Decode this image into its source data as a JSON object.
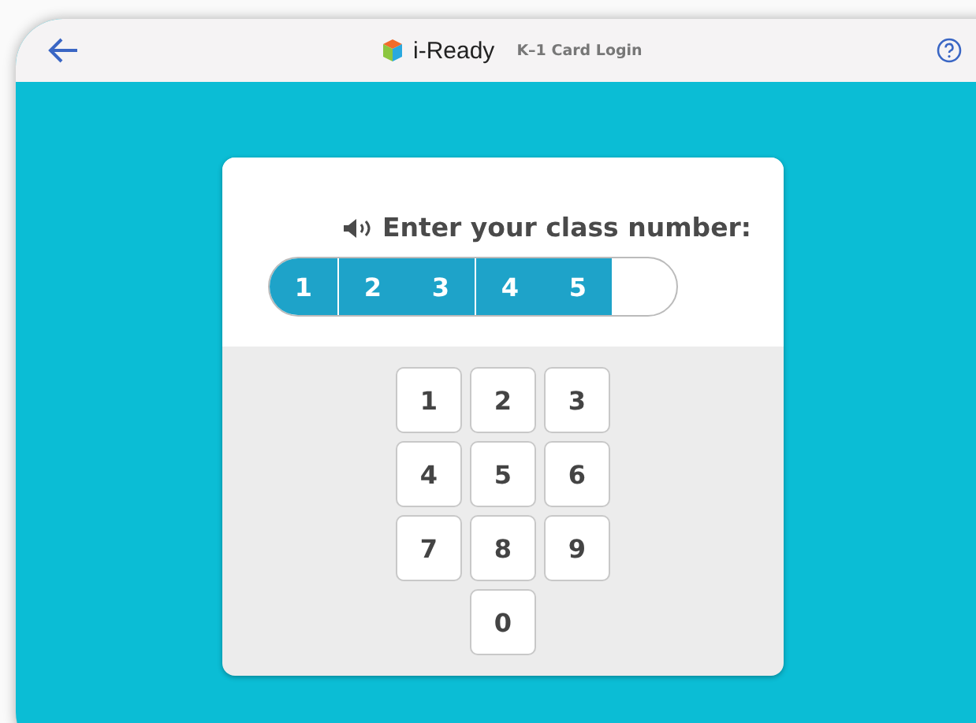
{
  "header": {
    "brand": "i-Ready",
    "title": "K–1 Card Login"
  },
  "prompt": "Enter your class number:",
  "entry": {
    "groups": [
      [
        "1"
      ],
      [
        "2",
        "3"
      ],
      [
        "4",
        "5"
      ]
    ]
  },
  "keypad": [
    [
      "1",
      "2",
      "3"
    ],
    [
      "4",
      "5",
      "6"
    ],
    [
      "7",
      "8",
      "9"
    ],
    [
      "0"
    ]
  ]
}
